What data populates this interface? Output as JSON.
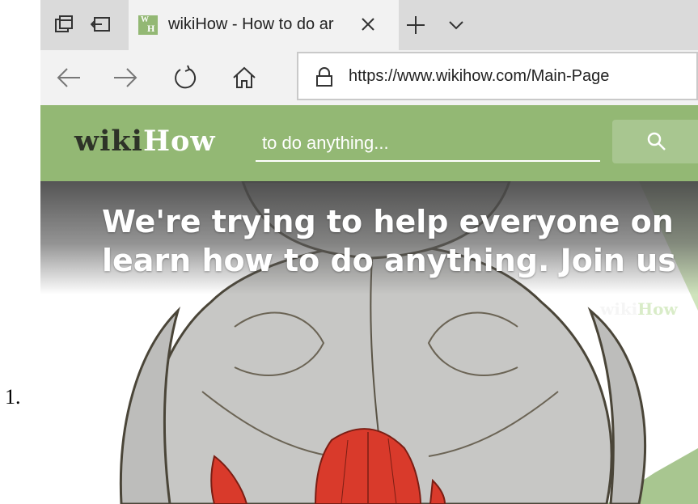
{
  "list_marker": "1.",
  "browser": {
    "tab_strip": {
      "icons": [
        "tab-actions-icon",
        "set-aside-tabs-icon"
      ],
      "active_tab": {
        "favicon_letters": [
          "W",
          "H"
        ],
        "favicon_color": "#93b874",
        "title": "wikiHow - How to do ar"
      },
      "new_tab_icon": "plus-icon",
      "tab_list_icon": "chevron-down-icon"
    },
    "nav": {
      "buttons": [
        "back-arrow-icon",
        "forward-arrow-icon",
        "refresh-icon",
        "home-icon"
      ],
      "address_bar": {
        "lock_icon": "lock-icon",
        "url": "https://www.wikihow.com/Main-Page"
      }
    }
  },
  "site": {
    "brand_color": "#93b874",
    "logo": {
      "wiki": "wiki",
      "how": "How"
    },
    "search": {
      "placeholder": "to do anything...",
      "icon": "search-icon"
    },
    "hero": {
      "line1": "We're trying to help everyone on",
      "line2": "learn how to do anything. Join us"
    },
    "watermark": {
      "wiki": "wiki",
      "how": "How"
    }
  }
}
